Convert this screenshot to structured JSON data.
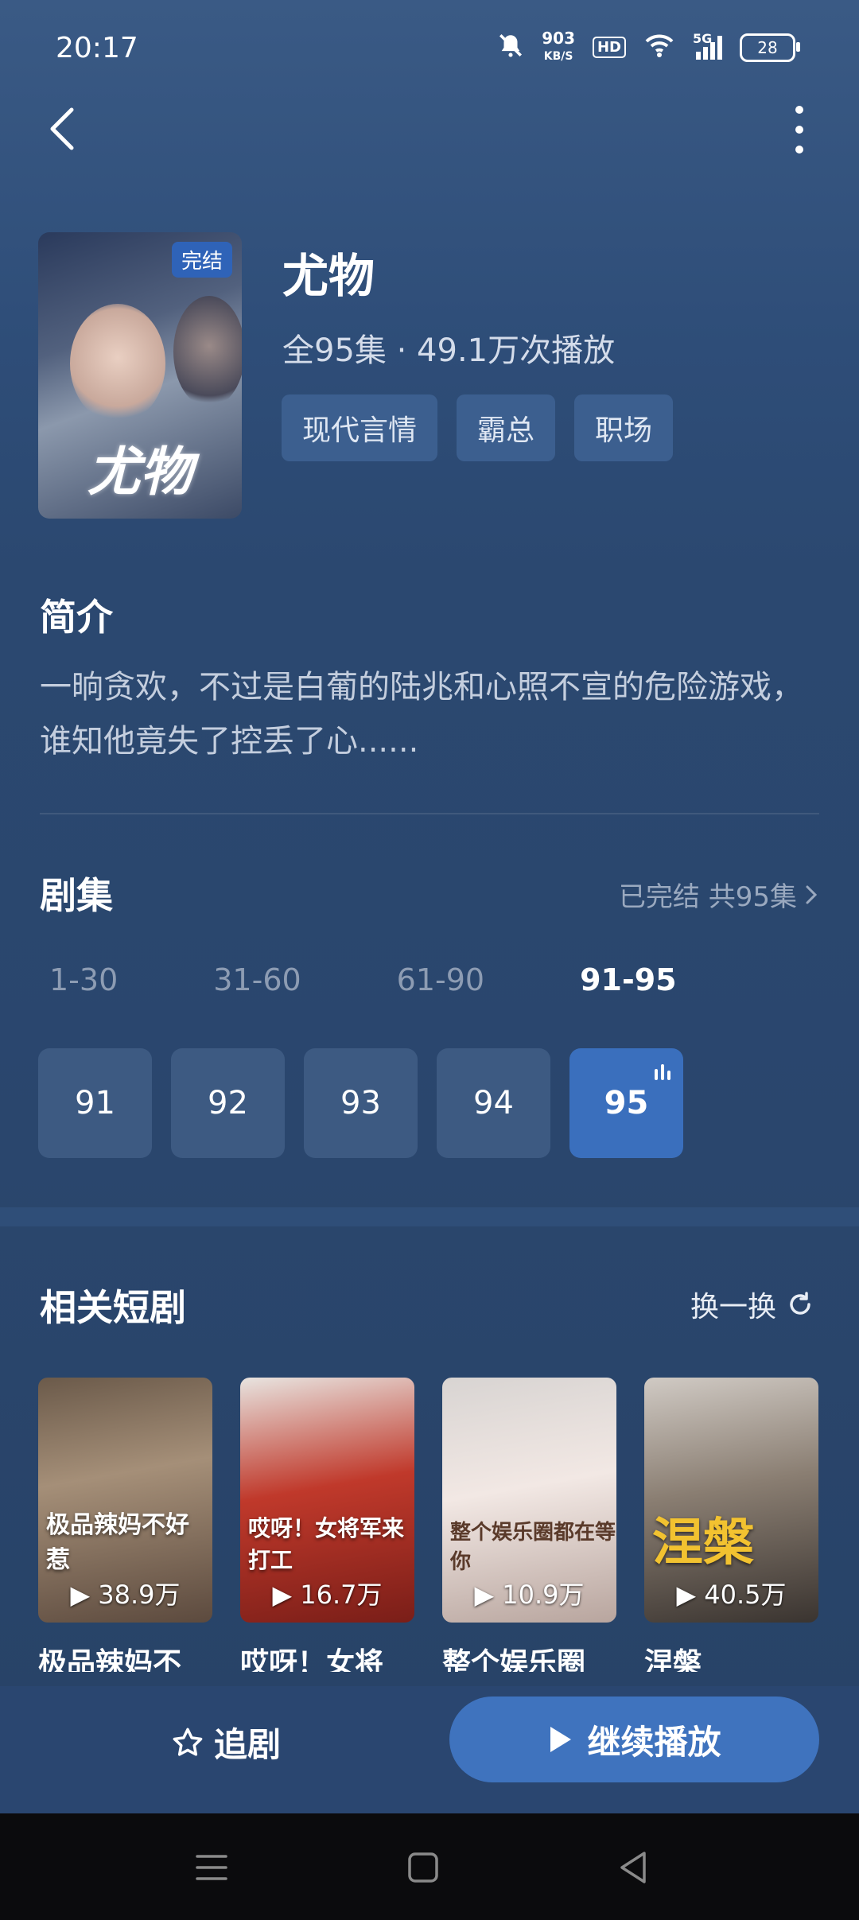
{
  "status_bar": {
    "time": "20:17",
    "speed_value": "903",
    "speed_unit": "KB/S",
    "hd": "HD",
    "network": "5G",
    "battery": "28"
  },
  "show": {
    "title": "尤物",
    "badge": "完结",
    "poster_title": "尤物",
    "meta": "全95集 · 49.1万次播放",
    "tags": [
      "现代言情",
      "霸总",
      "职场"
    ]
  },
  "intro": {
    "heading": "简介",
    "text": "一晌贪欢，不过是白葡的陆兆和心照不宣的危险游戏，谁知他竟失了控丢了心......"
  },
  "episodes": {
    "heading": "剧集",
    "status": "已完结 共95集",
    "ranges": [
      "1-30",
      "31-60",
      "61-90",
      "91-95"
    ],
    "active_range": "91-95",
    "items": [
      "91",
      "92",
      "93",
      "94",
      "95"
    ],
    "playing": "95"
  },
  "related": {
    "heading": "相关短剧",
    "shuffle_label": "换一换",
    "cards": [
      {
        "poster_text": "极品辣妈不好惹",
        "views": "38.9万",
        "title": "极品辣妈不"
      },
      {
        "poster_text": "哎呀！女将军来打工",
        "views": "16.7万",
        "title": "哎呀！女将"
      },
      {
        "poster_text": "整个娱乐圈都在等你",
        "views": "10.9万",
        "title": "整个娱乐圈"
      },
      {
        "poster_text": "涅槃",
        "views": "40.5万",
        "title": "涅槃"
      }
    ]
  },
  "actions": {
    "follow": "追剧",
    "continue": "继续播放"
  },
  "colors": {
    "accent": "#3f73be",
    "background": "#2b4870",
    "tag_bg": "#3c5f8f"
  }
}
